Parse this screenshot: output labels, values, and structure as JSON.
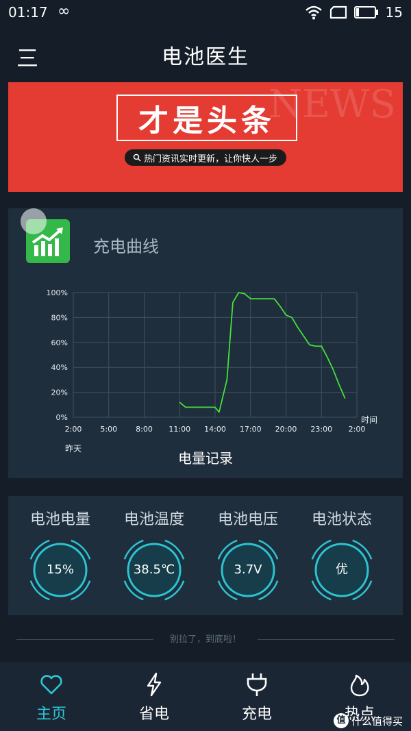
{
  "status_bar": {
    "time": "01:17",
    "battery_level": "15"
  },
  "app_bar": {
    "title": "电池医生"
  },
  "banner": {
    "background_text": "NEWS",
    "headline": "才是头条",
    "subline": "热门资讯实时更新，让你快人一步"
  },
  "chart_card": {
    "title": "充电曲线",
    "footer_label": "电量记录"
  },
  "chart_data": {
    "type": "line",
    "yticks": [
      "100%",
      "80%",
      "60%",
      "40%",
      "20%",
      "0%"
    ],
    "xticks": [
      "2:00",
      "5:00",
      "8:00",
      "11:00",
      "14:00",
      "17:00",
      "20:00",
      "23:00",
      "2:00"
    ],
    "x_unit_label": "时间",
    "x_start_note": "昨天",
    "ylim": [
      0,
      100
    ],
    "grid": true,
    "series": [
      {
        "color": "#45e03a",
        "x": [
          "11:00",
          "11:30",
          "14:00",
          "14:20",
          "15:00",
          "15:30",
          "16:00",
          "16:30",
          "17:00",
          "17:30",
          "18:00",
          "18:30",
          "19:00",
          "19:30",
          "20:00",
          "20:30",
          "21:00",
          "21:30",
          "22:00",
          "22:30",
          "23:00",
          "23:30",
          "0:00",
          "0:30",
          "1:00"
        ],
        "y": [
          12,
          8,
          8,
          4,
          30,
          92,
          100,
          99,
          95,
          95,
          95,
          95,
          95,
          89,
          82,
          80,
          72,
          65,
          58,
          57,
          57,
          48,
          38,
          26,
          15
        ]
      }
    ]
  },
  "stats": [
    {
      "label": "电池电量",
      "value": "15%"
    },
    {
      "label": "电池温度",
      "value": "38.5℃"
    },
    {
      "label": "电池电压",
      "value": "3.7V"
    },
    {
      "label": "电池状态",
      "value": "优"
    }
  ],
  "end_text": "别拉了，到底啦！",
  "nav": [
    {
      "label": "主页",
      "icon": "heart-icon"
    },
    {
      "label": "省电",
      "icon": "lightning-icon"
    },
    {
      "label": "充电",
      "icon": "plug-icon"
    },
    {
      "label": "热点",
      "icon": "flame-icon"
    }
  ],
  "watermark": {
    "badge": "值",
    "text": "什么值得买"
  },
  "colors": {
    "accent": "#2ec7d6",
    "chart_line": "#45e03a",
    "banner_red": "#e43b33"
  }
}
